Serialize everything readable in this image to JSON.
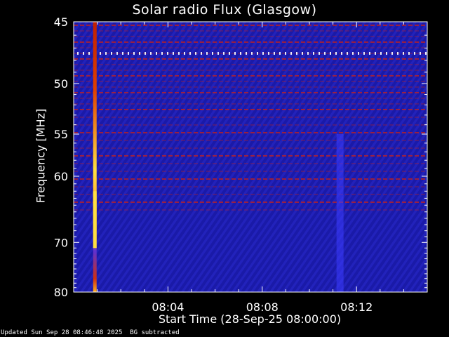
{
  "chart_data": {
    "type": "heatmap",
    "title": "Solar radio Flux (Glasgow)",
    "xlabel": "Start Time (28-Sep-25 08:00:00)",
    "ylabel": "Frequency [MHz]",
    "x_ticks": [
      "08:04",
      "08:08",
      "08:12"
    ],
    "x_tick_minutes": [
      4,
      8,
      12
    ],
    "xlim_minutes": [
      0,
      15
    ],
    "y_ticks": [
      45,
      50,
      55,
      60,
      70,
      80
    ],
    "ylim": [
      45,
      80
    ],
    "y_scale": "reciprocal",
    "colormap": [
      "#000090",
      "#2020ff",
      "#c01020",
      "#ff7000",
      "#ffff40"
    ],
    "events": [
      {
        "type": "broadband burst",
        "time_minutes": 0.9,
        "peak_freq_range": [
          62,
          71
        ]
      },
      {
        "type": "broadband enhancement",
        "time_minutes": 11.3,
        "freq_range": [
          55,
          80
        ]
      }
    ]
  },
  "footer": {
    "updated": "Updated Sun Sep 28 08:46:48 2025",
    "note": "BG subtracted"
  },
  "colors": {
    "background": "#000000",
    "plot_base": "#1a1aa8",
    "interference_line": "#b02030",
    "burst": "#ffe040"
  }
}
